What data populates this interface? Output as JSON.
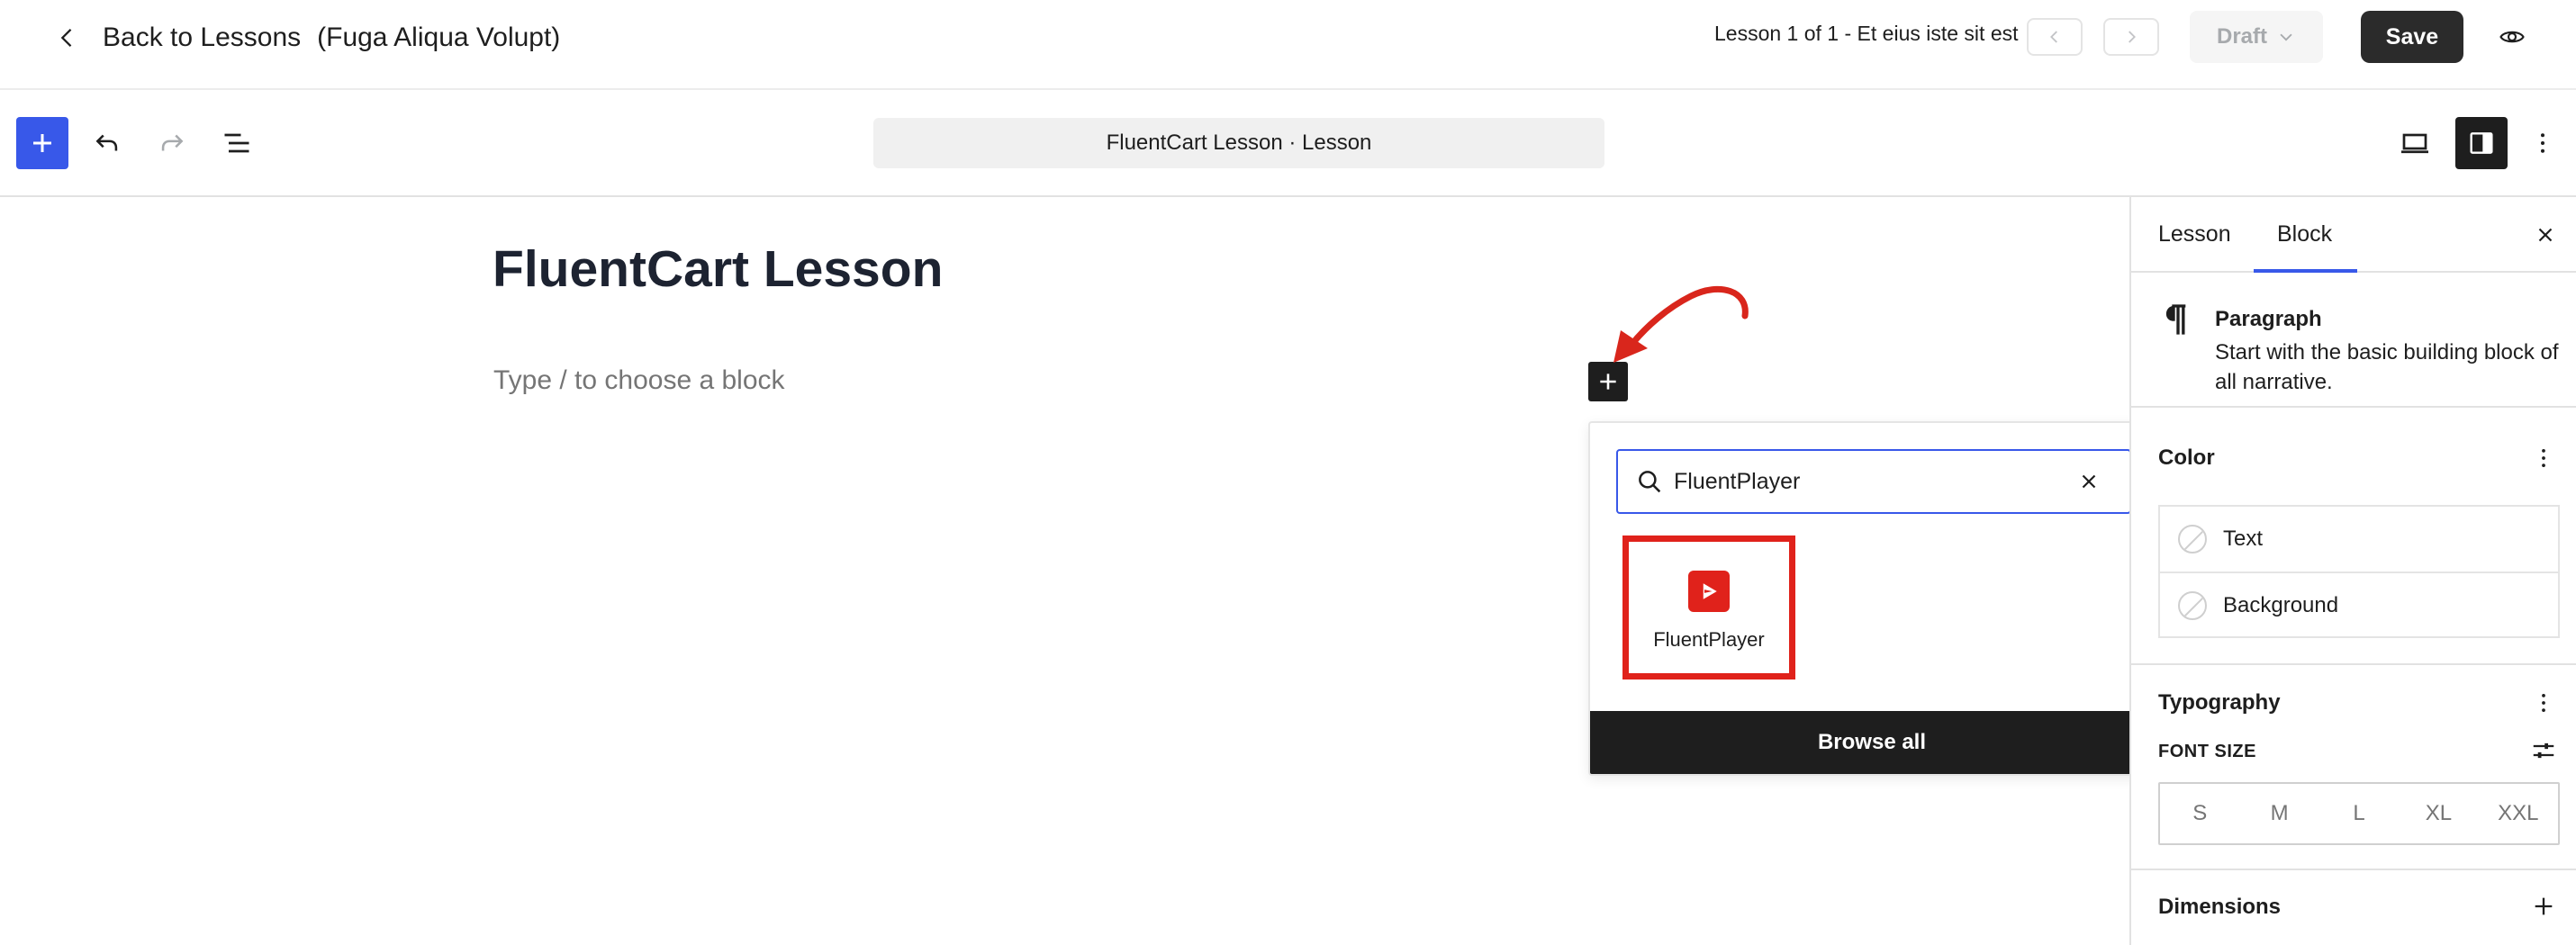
{
  "header": {
    "back_label": "Back to Lessons",
    "course_name": "(Fuga Aliqua Volupt)",
    "lesson_counter": "Lesson 1 of 1 - Et eius iste sit est",
    "status_label": "Draft",
    "save_label": "Save"
  },
  "toolbar": {
    "document_title": "FluentCart Lesson · Lesson"
  },
  "canvas": {
    "post_title": "FluentCart Lesson",
    "block_placeholder": "Type / to choose a block"
  },
  "inserter": {
    "search_value": "FluentPlayer",
    "results": [
      {
        "label": "FluentPlayer",
        "icon": "fluentplayer-icon",
        "highlighted": true
      }
    ],
    "browse_all_label": "Browse all"
  },
  "sidebar": {
    "tabs": [
      {
        "label": "Lesson",
        "active": false
      },
      {
        "label": "Block",
        "active": true
      }
    ],
    "block": {
      "name": "Paragraph",
      "description": "Start with the basic building block of all narrative."
    },
    "color": {
      "heading": "Color",
      "items": [
        {
          "label": "Text"
        },
        {
          "label": "Background"
        }
      ]
    },
    "typography": {
      "heading": "Typography",
      "font_size_label": "FONT SIZE",
      "sizes": [
        "S",
        "M",
        "L",
        "XL",
        "XXL"
      ]
    },
    "dimensions": {
      "heading": "Dimensions"
    }
  },
  "colors": {
    "accent": "#3858e9",
    "dark": "#1e1e1e",
    "highlight_red": "#e0221b",
    "annotation_arrow": "#d9261c"
  }
}
